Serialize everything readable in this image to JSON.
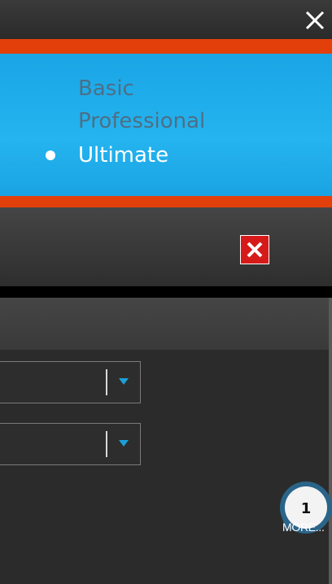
{
  "editions": {
    "items": [
      {
        "label": "Basic",
        "selected": false
      },
      {
        "label": "Professional",
        "selected": false
      },
      {
        "label": "Ultimate",
        "selected": true
      }
    ]
  },
  "colors": {
    "banner_blue": "#1fabe8",
    "accent_orange": "#e2400b",
    "close_red": "#d61a1a",
    "dropdown_arrow": "#1c9fd8"
  },
  "callout": {
    "number": "1"
  },
  "links": {
    "more": "MORE..."
  },
  "icons": {
    "top_close": "close-icon",
    "dialog_close": "close-icon",
    "dropdown_arrow": "chevron-down-icon"
  }
}
